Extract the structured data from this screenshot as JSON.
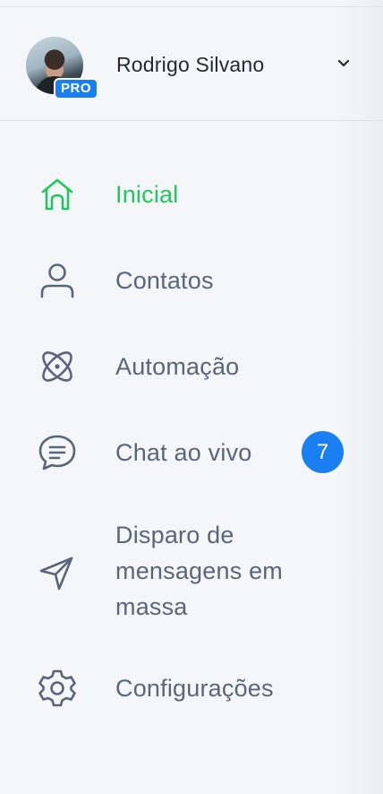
{
  "profile": {
    "name": "Rodrigo Silvano",
    "badge": "PRO"
  },
  "nav": {
    "items": [
      {
        "label": "Inicial",
        "icon": "home-icon",
        "active": true
      },
      {
        "label": "Contatos",
        "icon": "user-icon"
      },
      {
        "label": "Automação",
        "icon": "atom-icon"
      },
      {
        "label": "Chat ao vivo",
        "icon": "chat-bubble-icon",
        "badge": "7"
      },
      {
        "label_lines": [
          "Disparo de",
          "mensagens em",
          "massa"
        ],
        "icon": "send-icon"
      },
      {
        "label": "Configurações",
        "icon": "gear-icon"
      }
    ]
  },
  "colors": {
    "active": "#22c55e",
    "text": "#59667a",
    "accent": "#1a7ff0",
    "background": "#f5f6f9"
  }
}
